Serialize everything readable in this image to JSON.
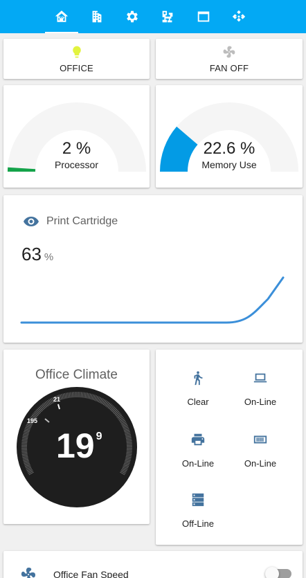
{
  "tabs": [
    {
      "icon": "home-assistant-icon",
      "active": true
    },
    {
      "icon": "office-building-icon"
    },
    {
      "icon": "settings-icon"
    },
    {
      "icon": "home-network-icon"
    },
    {
      "icon": "window-icon"
    },
    {
      "icon": "kodi-icon"
    }
  ],
  "buttons": {
    "office": {
      "label": "OFFICE",
      "icon": "lightbulb-icon",
      "icon_color": "#e2f33f"
    },
    "fan": {
      "label": "FAN OFF",
      "icon": "fan-icon",
      "icon_color": "#bdbdbd"
    }
  },
  "gauges": {
    "processor": {
      "value_text": "2 %",
      "label": "Processor",
      "value": 2,
      "min": 0,
      "max": 100,
      "color": "#14a34a"
    },
    "memory": {
      "value_text": "22.6 %",
      "label": "Memory Use",
      "value": 22.6,
      "min": 0,
      "max": 100,
      "color": "#039be5"
    }
  },
  "sensor": {
    "title": "Print Cartridge",
    "icon": "eye-icon",
    "value": "63",
    "unit": "%",
    "line_color": "#3b8fd9"
  },
  "climate": {
    "title": "Office Climate",
    "current": "19",
    "decimal": "9",
    "target_label": "21",
    "current_label": "195"
  },
  "entities": [
    {
      "name": "walk-icon",
      "state": "Clear"
    },
    {
      "name": "laptop-icon",
      "state": "On-Line"
    },
    {
      "name": "printer-icon",
      "state": "On-Line"
    },
    {
      "name": "memory-icon",
      "state": "On-Line"
    },
    {
      "name": "server-icon",
      "state": "Off-Line"
    }
  ],
  "fan_speed": {
    "label": "Office Fan Speed",
    "icon": "fan-icon",
    "toggle_on": false
  },
  "colors": {
    "header": "#03a9f4",
    "icon_primary": "#44739e",
    "gauge_track": "#f5f5f5"
  }
}
